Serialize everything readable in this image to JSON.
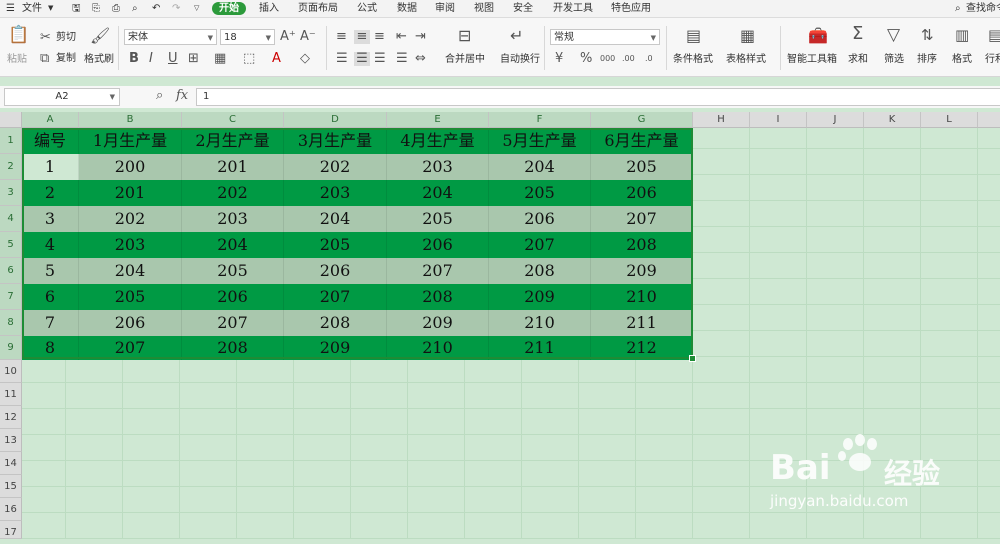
{
  "menu": {
    "file": "文件",
    "tabs": [
      "开始",
      "插入",
      "页面布局",
      "公式",
      "数据",
      "审阅",
      "视图",
      "安全",
      "开发工具",
      "特色应用"
    ],
    "search": "查找命令"
  },
  "ribbon": {
    "paste": "粘贴",
    "cut": "剪切",
    "copy": "复制",
    "format_painter": "格式刷",
    "font_name": "宋体",
    "font_size": "18",
    "merge_center": "合并居中",
    "wrap_text": "自动换行",
    "number_format": "常规",
    "conditional_format": "条件格式",
    "table_style": "表格样式",
    "smart_toolbox": "智能工具箱",
    "sum": "求和",
    "filter": "筛选",
    "sort": "排序",
    "format": "格式",
    "rowcol": "行和"
  },
  "formula_bar": {
    "name_box": "A2",
    "fx": "fx",
    "value": "1"
  },
  "columns": [
    "A",
    "B",
    "C",
    "D",
    "E",
    "F",
    "G",
    "H",
    "I",
    "J",
    "K",
    "L"
  ],
  "rows": [
    "1",
    "2",
    "3",
    "4",
    "5",
    "6",
    "7",
    "8",
    "9",
    "10",
    "11",
    "12",
    "13",
    "14",
    "15",
    "16",
    "17"
  ],
  "table": {
    "headers": [
      "编号",
      "1月生产量",
      "2月生产量",
      "3月生产量",
      "4月生产量",
      "5月生产量",
      "6月生产量"
    ],
    "data": [
      [
        "1",
        "200",
        "201",
        "202",
        "203",
        "204",
        "205"
      ],
      [
        "2",
        "201",
        "202",
        "203",
        "204",
        "205",
        "206"
      ],
      [
        "3",
        "202",
        "203",
        "204",
        "205",
        "206",
        "207"
      ],
      [
        "4",
        "203",
        "204",
        "205",
        "206",
        "207",
        "208"
      ],
      [
        "5",
        "204",
        "205",
        "206",
        "207",
        "208",
        "209"
      ],
      [
        "6",
        "205",
        "206",
        "207",
        "208",
        "209",
        "210"
      ],
      [
        "7",
        "206",
        "207",
        "208",
        "209",
        "210",
        "211"
      ],
      [
        "8",
        "207",
        "208",
        "209",
        "210",
        "211",
        "212"
      ]
    ]
  },
  "watermark": {
    "brand": "Bai",
    "brand2": "经验",
    "url": "jingyan.baidu.com"
  },
  "colors": {
    "accent": "#2c9a3b",
    "band_dark": "#009a44",
    "band_light": "#a9c7ad",
    "sheet_bg": "#cfe8d3"
  }
}
